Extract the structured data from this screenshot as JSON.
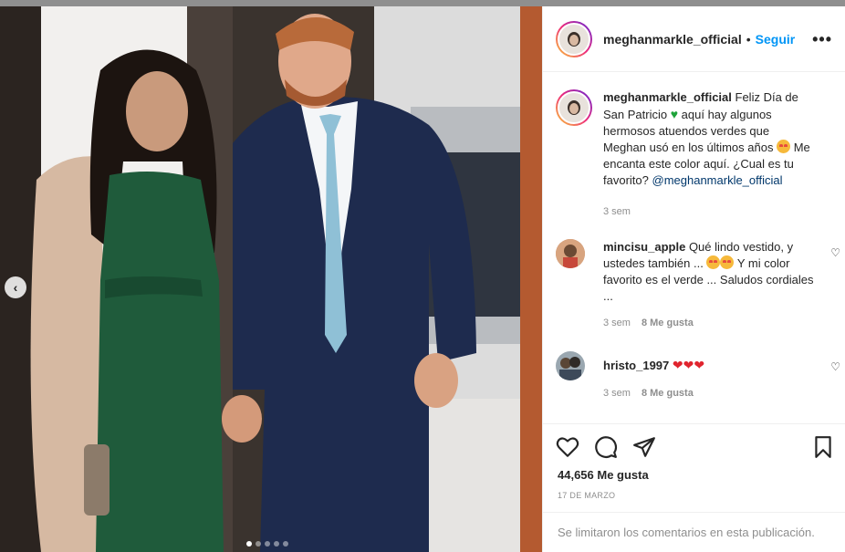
{
  "photo": {
    "prev_icon": "chevron-left-icon",
    "carousel_dots": 5,
    "active_dot": 0
  },
  "header": {
    "username": "meghanmarkle_official",
    "separator": "•",
    "follow_label": "Seguir",
    "more_icon": "more-horizontal-icon",
    "more_label": "•••"
  },
  "caption": {
    "username": "meghanmarkle_official",
    "text_1": "Feliz Día de San Patricio",
    "text_2": "aquí hay algunos hermosos atuendos verdes que Meghan usó en los últimos años",
    "text_3": "Me encanta este color aquí. ¿Cual es tu favorito?",
    "mention": "@meghanmarkle_official",
    "time": "3 sem"
  },
  "comments": [
    {
      "username": "mincisu_apple",
      "text_1": "Qué lindo vestido, y ustedes también ...",
      "text_2": "Y mi color favorito es el verde ... Saludos cordiales ...",
      "time": "3 sem",
      "likes": "8 Me gusta"
    },
    {
      "username": "hristo_1997",
      "text": "",
      "hearts": "❤❤❤",
      "time": "3 sem",
      "likes": "8 Me gusta"
    }
  ],
  "actions": {
    "like_icon": "heart-icon",
    "comment_icon": "comment-icon",
    "share_icon": "send-icon",
    "save_icon": "bookmark-icon",
    "likes_count": "44,656 Me gusta",
    "date": "17 DE MARZO",
    "comments_limited": "Se limitaron los comentarios en esta publicación."
  },
  "colors": {
    "accent_blue": "#0095f6",
    "mention_blue": "#00376b",
    "muted": "#8e8e8e",
    "text": "#262626"
  }
}
